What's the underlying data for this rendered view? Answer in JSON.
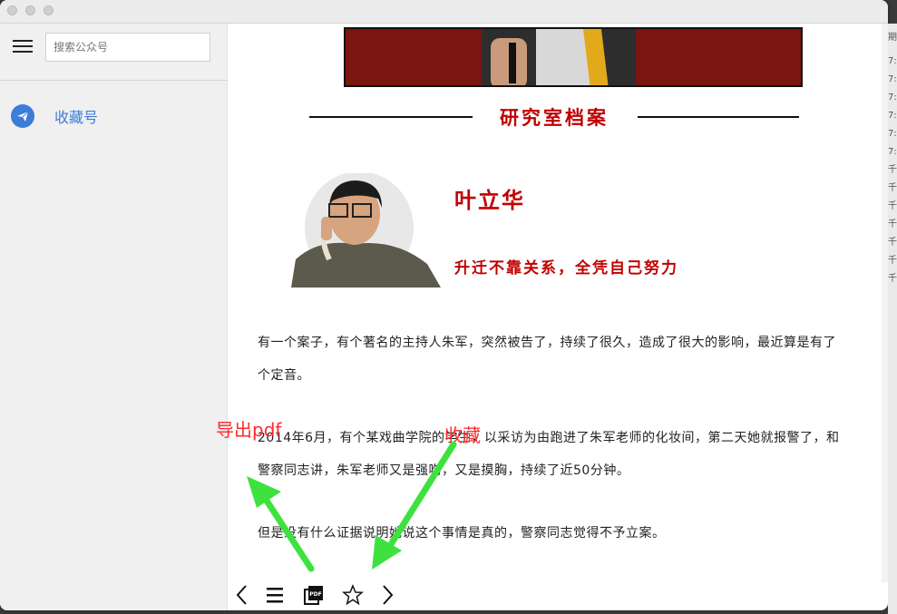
{
  "sidebar": {
    "search_placeholder": "搜索公众号",
    "items": [
      {
        "label": "收藏号",
        "icon": "paper-plane-icon"
      }
    ]
  },
  "article": {
    "banner_title": "研究室档案",
    "person_name": "叶立华",
    "person_motto": "升迁不靠关系，全凭自己努力",
    "paragraphs": [
      "有一个案子，有个著名的主持人朱军，突然被告了，持续了很久，造成了很大的影响，最近算是有了个定音。",
      "2014年6月，有个某戏曲学院的学生，以采访为由跑进了朱军老师的化妆间，第二天她就报警了，和警察同志讲，朱军老师又是强吻，又是摸胸，持续了近50分钟。",
      "但是没有什么证据说明她说这个事情是真的，警察同志觉得不予立案。"
    ]
  },
  "toolbar": {
    "buttons": [
      "chevron-left-icon",
      "list-icon",
      "pdf-export-icon",
      "star-icon",
      "chevron-right-icon"
    ]
  },
  "annotations": {
    "export_pdf": "导出pdf",
    "favorite": "收藏"
  },
  "background_window": {
    "rows": [
      "期",
      "7:",
      "7:",
      "7:",
      "7:",
      "7:",
      "7:",
      "千",
      "千",
      "千",
      "千",
      "千",
      "千",
      "千"
    ]
  },
  "colors": {
    "accent_blue": "#3b7dd8",
    "banner_red": "#c00000",
    "annotation_red": "#ff2a2a",
    "arrow_green": "#3ee23e"
  }
}
